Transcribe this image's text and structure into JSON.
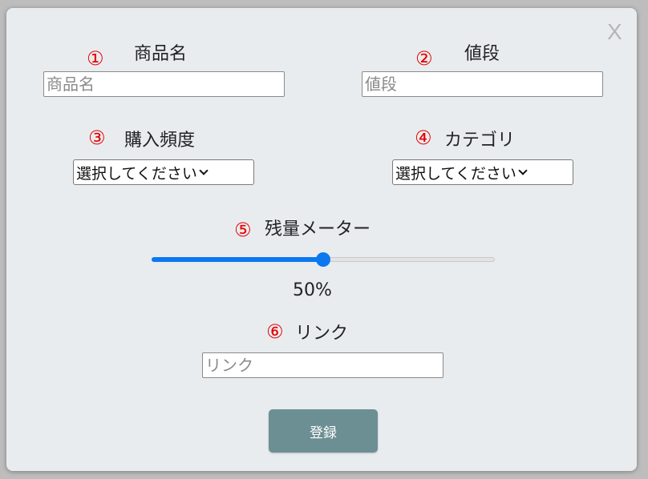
{
  "close_label": "X",
  "fields": {
    "product_name": {
      "number": "①",
      "label": "商品名",
      "placeholder": "商品名"
    },
    "price": {
      "number": "②",
      "label": "値段",
      "placeholder": "値段"
    },
    "frequency": {
      "number": "③",
      "label": "購入頻度",
      "selected": "選択してください"
    },
    "category": {
      "number": "④",
      "label": "カテゴリ",
      "selected": "選択してください"
    },
    "remaining": {
      "number": "⑤",
      "label": "残量メーター",
      "value_text": "50%",
      "value": 0.5
    },
    "link": {
      "number": "⑥",
      "label": "リンク",
      "placeholder": "リンク"
    }
  },
  "submit_label": "登録",
  "colors": {
    "background": "#e9ecef",
    "annotation_number": "#e60000",
    "slider_accent": "#0b78f0",
    "button": "#6c8f93"
  },
  "icons": {
    "close": "close-icon",
    "dropdown": "chevron-down-icon"
  }
}
